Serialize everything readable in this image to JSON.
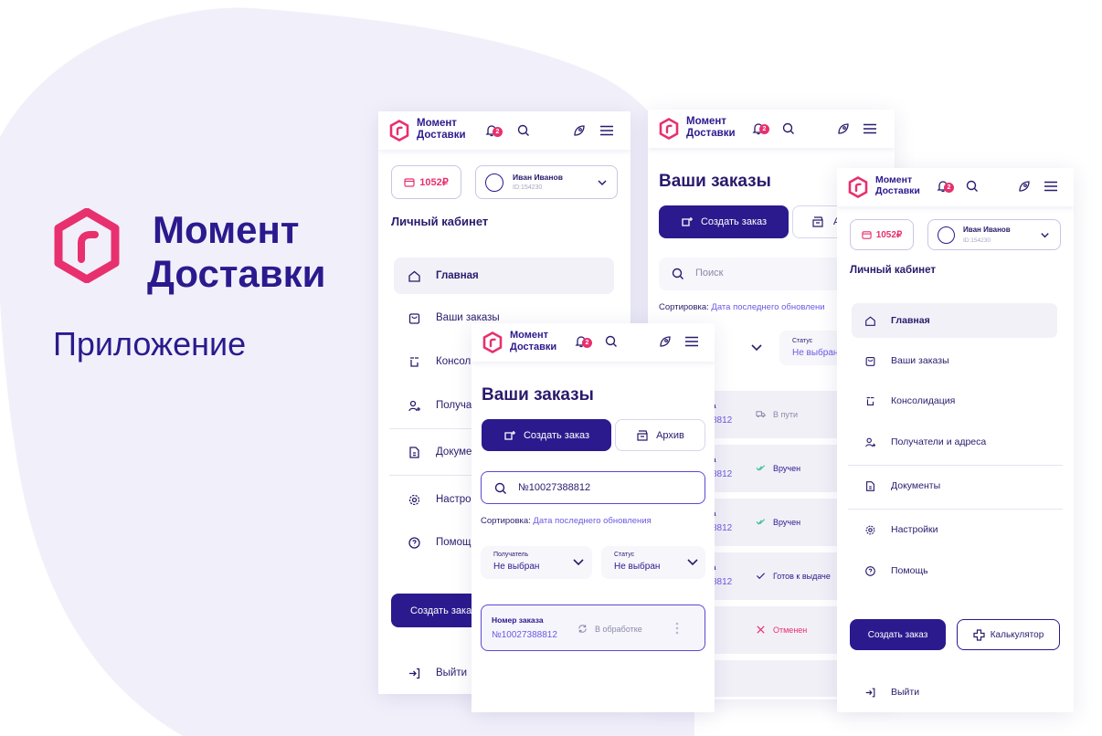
{
  "brand": {
    "name_line1": "Момент",
    "name_line2": "Доставки",
    "caption": "Приложение",
    "accent": "#e8306e",
    "primary": "#2b1a8e"
  },
  "header": {
    "logo_text": "Момент\nДоставки",
    "notif_count": "2"
  },
  "cabinet": {
    "balance": "1052₽",
    "user_name": "Иван Иванов",
    "user_id": "ID:154230",
    "title": "Личный кабинет",
    "nav": [
      {
        "label": "Главная",
        "icon": "home-icon"
      },
      {
        "label": "Ваши заказы",
        "icon": "bag-icon"
      },
      {
        "label": "Консолидация",
        "icon": "consolidation-icon"
      },
      {
        "label": "Получатели и адреса",
        "icon": "user-plus-icon"
      },
      {
        "label": "Документы",
        "icon": "document-icon"
      },
      {
        "label": "Настройки",
        "icon": "gear-icon"
      },
      {
        "label": "Помощь",
        "icon": "help-icon"
      }
    ],
    "create_order": "Создать заказ",
    "calculator": "Калькулятор",
    "logout": "Выйти"
  },
  "cabinet_left": {
    "nav_partial": [
      "Главная",
      "Ваши заказы",
      "Консол",
      "Получа",
      "Докуме",
      "Настро",
      "Помощ"
    ],
    "create_partial": "Создать зака",
    "logout": "Выйти"
  },
  "orders_back": {
    "title": "Ваши заказы",
    "create_order": "Создать заказ",
    "archive_partial": "А",
    "search_placeholder": "Поиск",
    "sort_label": "Сортировка:",
    "sort_value": "Дата последнего обновлени",
    "filter_status_label": "Статус",
    "filter_status_value": "Не выбран",
    "rows": [
      {
        "head": "а",
        "num": "8812",
        "status": "В пути",
        "color": "#8a8aa8"
      },
      {
        "head": "а",
        "num": "8812",
        "status": "Вручен",
        "color": "#2b1a8e"
      },
      {
        "head": "а",
        "num": "8812",
        "status": "Вручен",
        "color": "#2b1a8e"
      },
      {
        "head": "а",
        "num": "8812",
        "status": "Готов к выдаче",
        "color": "#2b1a8e"
      },
      {
        "head": "",
        "num": "",
        "status": "Отменен",
        "color": "#e8306e"
      }
    ]
  },
  "orders_front": {
    "title": "Ваши заказы",
    "create_order": "Создать заказ",
    "archive": "Архив",
    "search_value": "№10027388812",
    "sort_label": "Сортировка:",
    "sort_value": "Дата последнего обновления",
    "filter_recipient_label": "Получатель",
    "filter_recipient_value": "Не выбран",
    "filter_status_label": "Статус",
    "filter_status_value": "Не выбран",
    "order_label": "Номер заказа",
    "order_number": "№10027388812",
    "order_status": "В обработке"
  }
}
